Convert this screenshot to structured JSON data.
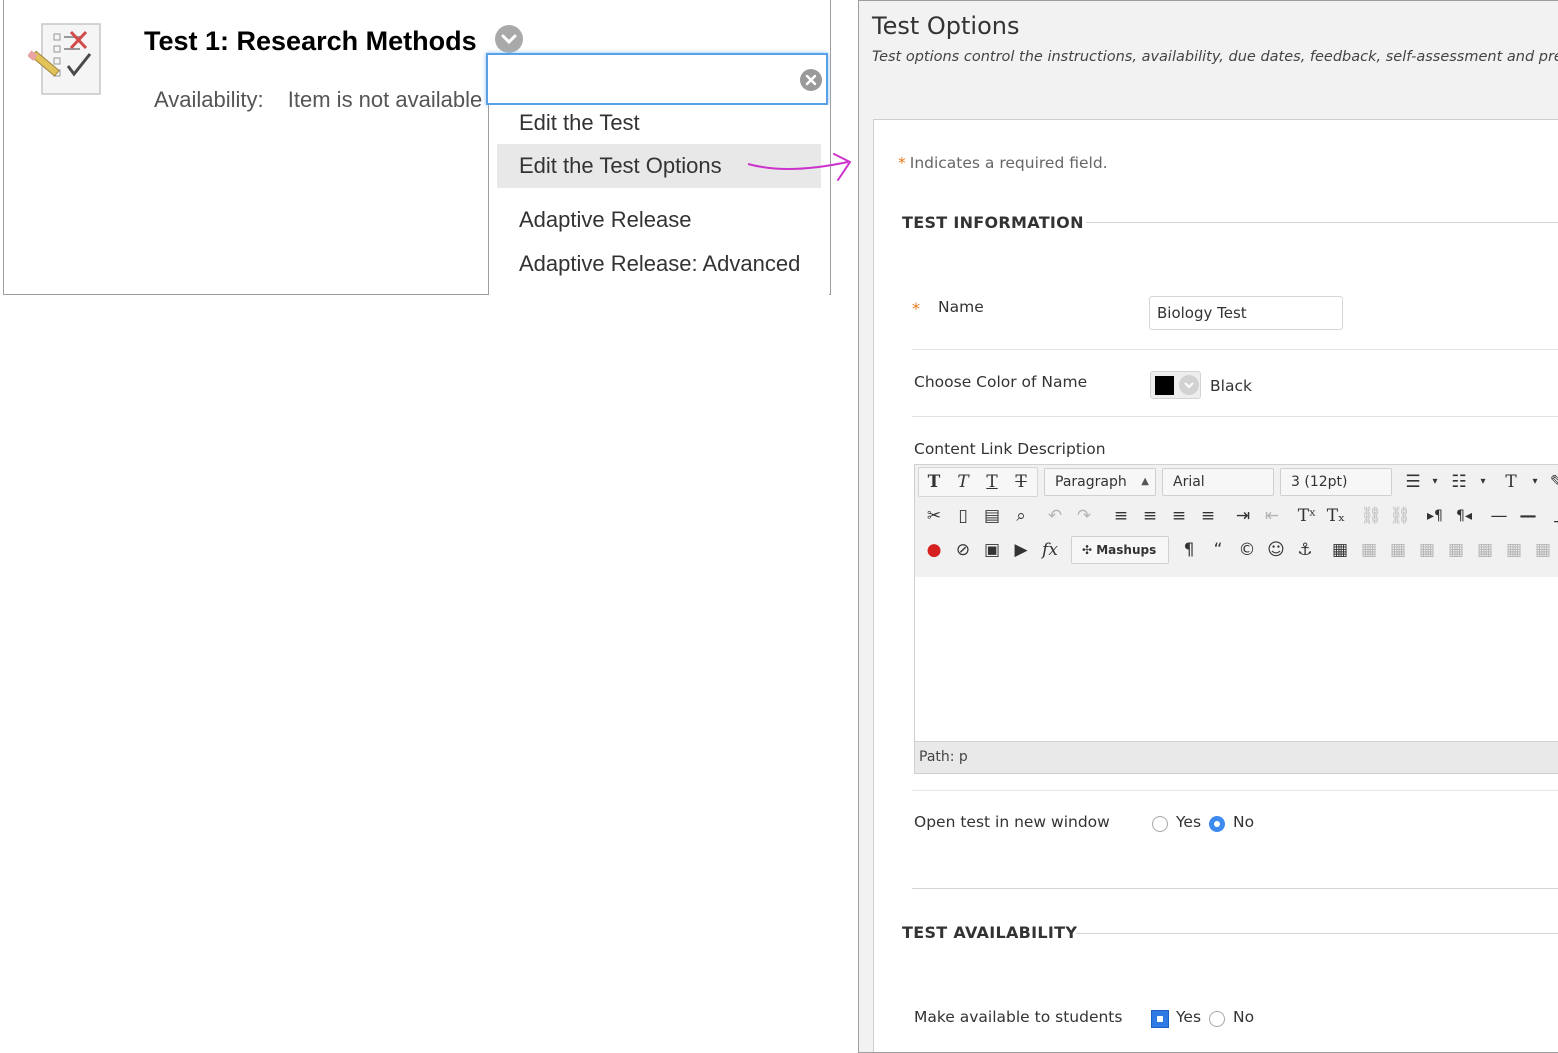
{
  "left": {
    "title": "Test 1: Research Methods",
    "availability_label": "Availability:",
    "availability_value": "Item is not available",
    "menu_search": {
      "value": "",
      "placeholder": ""
    },
    "menu_items": [
      "Edit the Test",
      "Edit the Test Options",
      "Adaptive Release",
      "Adaptive Release: Advanced"
    ],
    "active_menu_item": "Edit the Test Options"
  },
  "right": {
    "page_title": "Test Options",
    "page_description": "Test options control the instructions, availability, due dates, feedback, self-assessment and presenta",
    "required_note": "Indicates a required field.",
    "required_star": "*",
    "sections": {
      "test_information": "TEST INFORMATION",
      "test_availability": "TEST AVAILABILITY"
    },
    "name_label": "Name",
    "name_value": "Biology Test",
    "color_label": "Choose Color of Name",
    "color_value": "Black",
    "color_swatch": "#000000",
    "content_link_label": "Content Link Description",
    "editor": {
      "format_select": "Paragraph",
      "font_select": "Arial",
      "size_select": "3 (12pt)",
      "mashups_label": "Mashups",
      "path_text": "Path: p"
    },
    "open_new_window_label": "Open test in new window",
    "open_new_window_options": [
      "Yes",
      "No"
    ],
    "open_new_window_selected": "No",
    "make_available_label": "Make available to students",
    "make_available_options": [
      "Yes",
      "No"
    ],
    "make_available_selected": "Yes"
  },
  "colors": {
    "accent": "#3d8bf0",
    "required": "#e87b1e",
    "arrow": "#cc33cc",
    "focus_border": "#5aa0e6"
  }
}
